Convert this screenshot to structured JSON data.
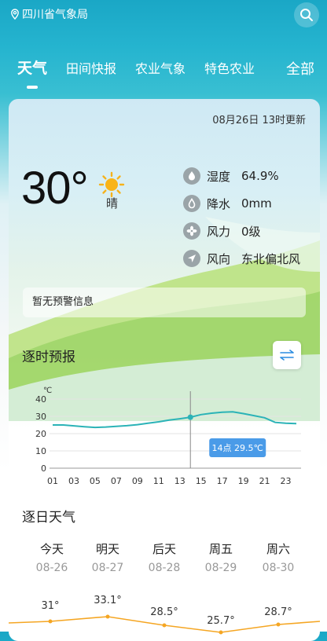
{
  "header": {
    "location": "四川省气象局"
  },
  "tabs": [
    {
      "label": "天气"
    },
    {
      "label": "田间快报"
    },
    {
      "label": "农业气象"
    },
    {
      "label": "特色农业"
    },
    {
      "label": "全部"
    }
  ],
  "weather": {
    "update_time": "08月26日 13时更新",
    "temperature": "30°",
    "condition": "晴",
    "metrics": [
      {
        "label": "湿度",
        "value": "64.9%",
        "icon": "humidity-icon"
      },
      {
        "label": "降水",
        "value": "0mm",
        "icon": "rain-drop-icon"
      },
      {
        "label": "风力",
        "value": "0级",
        "icon": "fan-icon"
      },
      {
        "label": "风向",
        "value": "东北偏北风",
        "icon": "direction-icon"
      }
    ],
    "warning": "暂无预警信息"
  },
  "hourly": {
    "title": "逐时预报",
    "tooltip": "14点 29.5℃"
  },
  "chart_data": {
    "type": "line",
    "ylabel": "℃",
    "ylim": [
      0,
      40
    ],
    "yticks": [
      0,
      10,
      20,
      30,
      40
    ],
    "x": [
      "01",
      "02",
      "03",
      "04",
      "05",
      "06",
      "07",
      "08",
      "09",
      "10",
      "11",
      "12",
      "13",
      "14",
      "15",
      "16",
      "17",
      "18",
      "19",
      "20",
      "21",
      "22",
      "23",
      "24"
    ],
    "xticks": [
      "01",
      "03",
      "05",
      "07",
      "09",
      "11",
      "13",
      "15",
      "17",
      "19",
      "21",
      "23"
    ],
    "values": [
      25,
      25,
      24.5,
      24,
      23.6,
      23.8,
      24.2,
      24.6,
      25.2,
      26,
      26.8,
      27.8,
      28.6,
      29.5,
      31,
      31.8,
      32.4,
      32.6,
      31.6,
      30.4,
      29.2,
      26.5,
      26,
      25.8
    ],
    "highlight": {
      "x": "14",
      "value": 29.5
    },
    "color": "#2bb3b7"
  },
  "daily": {
    "title": "逐日天气",
    "days": [
      {
        "name": "今天",
        "date": "08-26",
        "high": "31°"
      },
      {
        "name": "明天",
        "date": "08-27",
        "high": "33.1°"
      },
      {
        "name": "后天",
        "date": "08-28",
        "high": "28.5°"
      },
      {
        "name": "周五",
        "date": "08-29",
        "high": "25.7°"
      },
      {
        "name": "周六",
        "date": "08-30",
        "high": "28.7°"
      }
    ],
    "line_color": "#f5a623"
  }
}
